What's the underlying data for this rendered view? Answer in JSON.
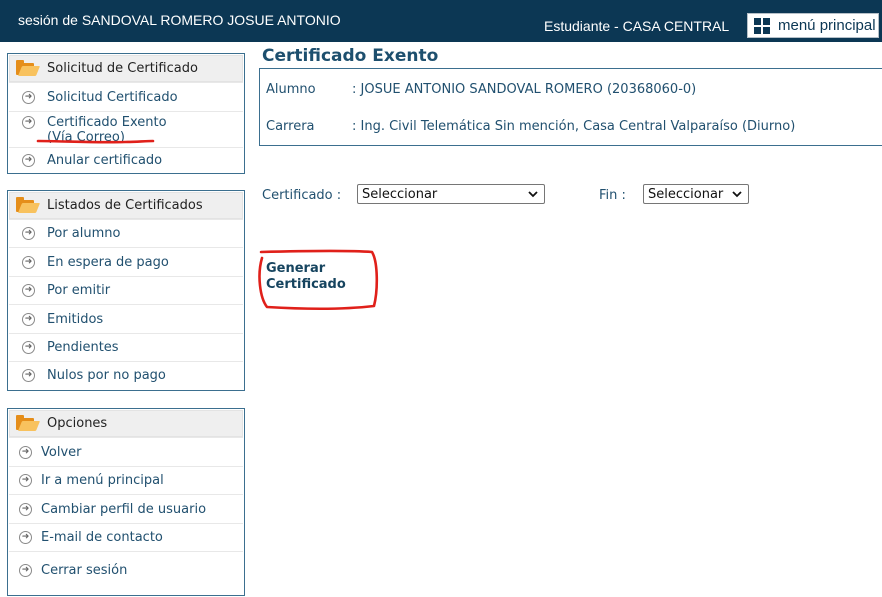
{
  "header": {
    "session_text": "sesión de SANDOVAL ROMERO JOSUE ANTONIO",
    "role_text": "Estudiante - CASA CENTRAL",
    "menu_button_label": "menú principal"
  },
  "sidebar": {
    "solicitud": {
      "title": "Solicitud de Certificado",
      "items": [
        {
          "label": "Solicitud Certificado"
        },
        {
          "label_line1": "Certificado Exento",
          "label_line2": "(Vía Correo)"
        },
        {
          "label": "Anular certificado"
        }
      ]
    },
    "listados": {
      "title": "Listados de Certificados",
      "items": [
        {
          "label": "Por alumno"
        },
        {
          "label": "En espera de pago"
        },
        {
          "label": "Por emitir"
        },
        {
          "label": "Emitidos"
        },
        {
          "label": "Pendientes"
        },
        {
          "label": "Nulos por no pago"
        }
      ]
    },
    "opciones": {
      "title": "Opciones",
      "items": [
        {
          "label": "Volver"
        },
        {
          "label": "Ir a menú principal"
        },
        {
          "label": "Cambiar perfil de usuario"
        },
        {
          "label": "E-mail de contacto"
        },
        {
          "label": "Cerrar sesión"
        }
      ]
    }
  },
  "main": {
    "title": "Certificado Exento",
    "student": {
      "alumno_label": "Alumno",
      "alumno_value": ":  JOSUE ANTONIO SANDOVAL ROMERO (20368060-0)",
      "carrera_label": "Carrera",
      "carrera_value": ":  Ing. Civil Telemática Sin mención, Casa Central Valparaíso (Diurno)"
    },
    "form": {
      "certificado_label": "Certificado  :",
      "certificado_value": "Seleccionar",
      "fin_label": "Fin   :",
      "fin_value": "Seleccionar"
    },
    "generate_line1": "Generar",
    "generate_line2": "Certificado"
  },
  "colors": {
    "header_bg": "#0c3754",
    "link_text": "#21506f",
    "box_border": "#3b6f8f",
    "annotation_red": "#e0201a",
    "folder_orange": "#e58e1a"
  },
  "icons": {
    "menu": "grid-icon",
    "section": "folder-open-icon",
    "item": "arrow-right-circle-icon",
    "select": "chevron-down-icon"
  }
}
